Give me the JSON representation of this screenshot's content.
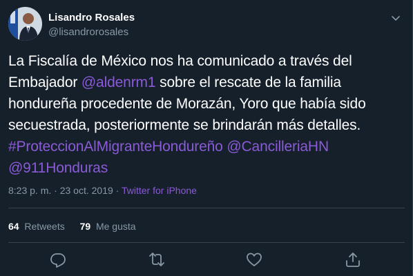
{
  "user": {
    "display_name": "Lisandro Rosales",
    "handle": "@lisandrorosales"
  },
  "tweet": {
    "seg1": "La Fiscalía de México nos ha comunicado a través del Embajador ",
    "mention1": "@aldenrm1",
    "seg2": " sobre el rescate de la familia hondureña procedente de Morazán, Yoro que había sido secuestrada, posteriormente se brindarán más detalles. ",
    "hashtag": "#ProteccionAlMigranteHondureño",
    "seg3": " ",
    "mention2": "@CancilleriaHN",
    "seg4": " ",
    "mention3": "@911Honduras"
  },
  "meta": {
    "time": "8:23 p. m.",
    "separator": " · ",
    "date": "23 oct. 2019",
    "source": "Twitter for iPhone"
  },
  "stats": {
    "retweets_count": "64",
    "retweets_label": "Retweets",
    "likes_count": "79",
    "likes_label": "Me gusta"
  },
  "colors": {
    "background": "#15202b",
    "text": "#ffffff",
    "secondary": "#8899a6",
    "link": "#8b5ad8",
    "divider": "#38444d"
  },
  "icons": {
    "caret": "chevron-down-icon",
    "reply": "reply-icon",
    "retweet": "retweet-icon",
    "like": "heart-icon",
    "share": "share-icon"
  }
}
